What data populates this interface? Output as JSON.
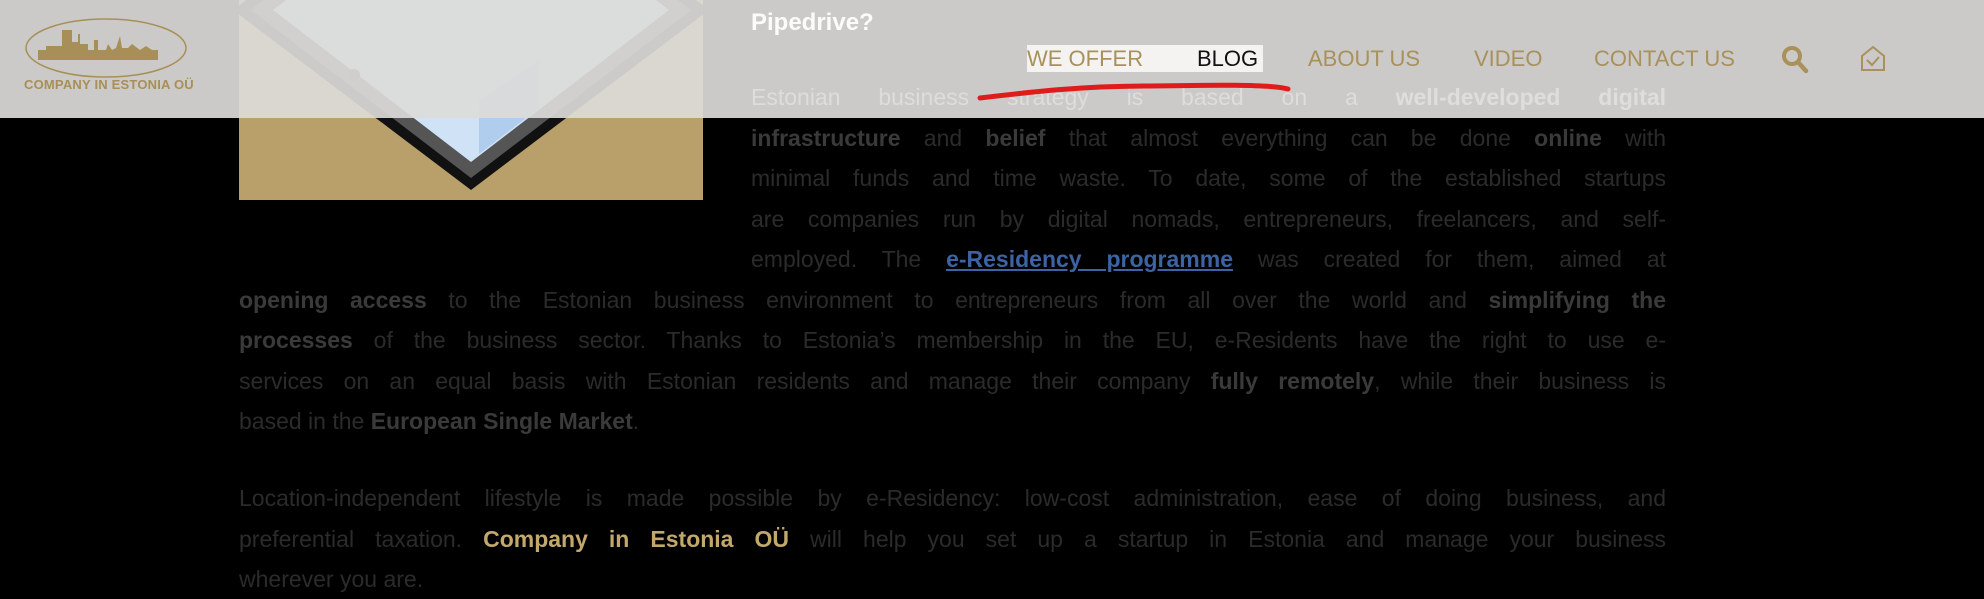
{
  "header": {
    "logo_text": "COMPANY IN ESTONIA OÜ",
    "nav": [
      {
        "label": "WE OFFER",
        "active": false
      },
      {
        "label": "BLOG",
        "active": true
      },
      {
        "label": "ABOUT US",
        "active": false
      },
      {
        "label": "VIDEO",
        "active": false
      },
      {
        "label": "CONTACT US",
        "active": false
      }
    ],
    "icons": [
      "search-icon",
      "mail-icon"
    ],
    "accent_color": "#a8915b"
  },
  "article": {
    "heading": "Pipedrive?",
    "paragraph1": [
      [
        {
          "t": "Estonian business strategy is based on a "
        },
        {
          "t": "well-developed digital",
          "b": true
        }
      ],
      [
        {
          "t": "infrastructure",
          "b": true
        },
        {
          "t": " and "
        },
        {
          "t": "belief",
          "b": true
        },
        {
          "t": " that almost everything can be done "
        },
        {
          "t": "online",
          "b": true
        },
        {
          "t": " with"
        }
      ],
      [
        {
          "t": "minimal funds and time waste. To date, some of the established startups"
        }
      ],
      [
        {
          "t": "are companies run by digital nomads, entrepreneurs, freelancers, and self-"
        }
      ],
      [
        {
          "t": "employed. The "
        },
        {
          "t": "e-Residency programme",
          "link": true
        },
        {
          "t": " was created for them, aimed at"
        }
      ],
      [
        {
          "t": "opening access",
          "b": true
        },
        {
          "t": " to the Estonian business environment to entrepreneurs from all over the world and "
        },
        {
          "t": "simplifying the",
          "b": true
        }
      ],
      [
        {
          "t": "processes",
          "b": true
        },
        {
          "t": " of the business sector. Thanks to Estonia’s membership in the EU, e-Residents have the right to use e-"
        }
      ],
      [
        {
          "t": "services on an equal basis with Estonian residents and manage their company "
        },
        {
          "t": "fully remotely",
          "b": true
        },
        {
          "t": ", while their business is"
        }
      ],
      [
        {
          "t": "based in the "
        },
        {
          "t": "European Single Market",
          "b": true
        },
        {
          "t": "."
        }
      ]
    ],
    "paragraph2": [
      [
        {
          "t": "Location-independent lifestyle is made possible by e-Residency: low-cost administration, ease of doing business, and"
        }
      ],
      [
        {
          "t": "preferential taxation. "
        },
        {
          "t": "Company in Estonia OÜ",
          "brand": true
        },
        {
          "t": " will help you set up a startup in Estonia and manage your business"
        }
      ],
      [
        {
          "t": "wherever you are."
        }
      ]
    ],
    "link_color": "#3d63a3",
    "brand_color": "#c2a86b"
  }
}
